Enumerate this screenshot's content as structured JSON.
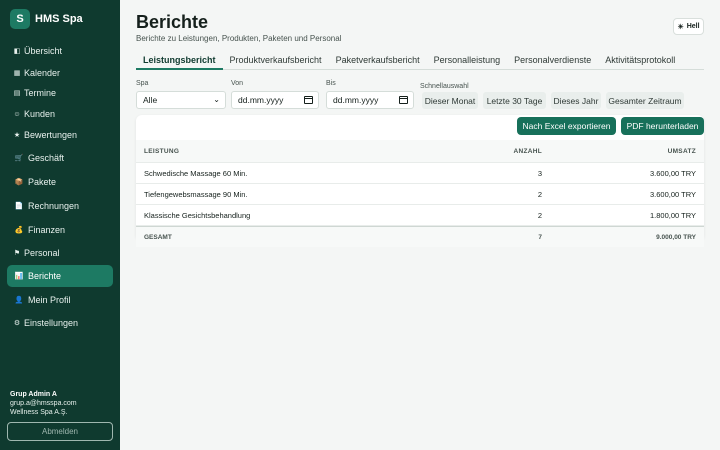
{
  "brand": {
    "logo": "S",
    "name": "HMS Spa"
  },
  "sidebar": {
    "items": [
      {
        "icon": "◧",
        "label": "Übersicht",
        "name": "overview"
      },
      {
        "icon": "▦",
        "label": "Kalender",
        "name": "calendar"
      },
      {
        "icon": "▤",
        "label": "Termine",
        "name": "appointments"
      },
      {
        "icon": "☺",
        "label": "Kunden",
        "name": "customers"
      },
      {
        "icon": "★",
        "label": "Bewertungen",
        "name": "reviews"
      },
      {
        "icon": "🛒",
        "label": "Geschäft",
        "name": "shop"
      },
      {
        "icon": "📦",
        "label": "Pakete",
        "name": "packages"
      },
      {
        "icon": "📄",
        "label": "Rechnungen",
        "name": "invoices"
      },
      {
        "icon": "💰",
        "label": "Finanzen",
        "name": "finances"
      },
      {
        "icon": "⚑",
        "label": "Personal",
        "name": "staff"
      },
      {
        "icon": "📊",
        "label": "Berichte",
        "name": "reports"
      },
      {
        "icon": "👤",
        "label": "Mein Profil",
        "name": "profile"
      },
      {
        "icon": "⚙",
        "label": "Einstellungen",
        "name": "settings"
      }
    ],
    "active": "Berichte"
  },
  "user": {
    "name": "Grup Admin A",
    "email": "grup.a@hmsspa.com",
    "company": "Wellness Spa A.Ş."
  },
  "logout_label": "Abmelden",
  "header": {
    "title": "Berichte",
    "subtitle": "Berichte zu Leistungen, Produkten, Paketen und Personal",
    "theme_icon": "☀",
    "theme_label": "Hell"
  },
  "tabs": [
    "Leistungsbericht",
    "Produktverkaufsbericht",
    "Paketverkaufsbericht",
    "Personalleistung",
    "Personalverdienste",
    "Aktivitätsprotokoll"
  ],
  "active_tab": "Leistungsbericht",
  "filters": {
    "spa_label": "Spa",
    "spa_value": "Alle",
    "from_label": "Von",
    "from_placeholder": "dd.mm.yyyy",
    "to_label": "Bis",
    "to_placeholder": "dd.mm.yyyy",
    "quick_label": "Schnellauswahl",
    "quick": [
      "Dieser Monat",
      "Letzte 30 Tage",
      "Dieses Jahr",
      "Gesamter Zeitraum"
    ]
  },
  "actions": {
    "excel": "Nach Excel exportieren",
    "pdf": "PDF herunterladen"
  },
  "table": {
    "columns": [
      "LEISTUNG",
      "ANZAHL",
      "UMSATZ"
    ],
    "rows": [
      {
        "service": "Schwedische Massage 60 Min.",
        "count": "3",
        "revenue": "3.600,00 TRY"
      },
      {
        "service": "Tiefengewebsmassage 90 Min.",
        "count": "2",
        "revenue": "3.600,00 TRY"
      },
      {
        "service": "Klassische Gesichtsbehandlung",
        "count": "2",
        "revenue": "1.800,00 TRY"
      }
    ],
    "total": {
      "label": "GESAMT",
      "count": "7",
      "revenue": "9.000,00 TRY"
    }
  },
  "colors": {
    "sidebar_bg": "#0f3a2f",
    "accent": "#1d7a63",
    "button": "#17705a"
  }
}
